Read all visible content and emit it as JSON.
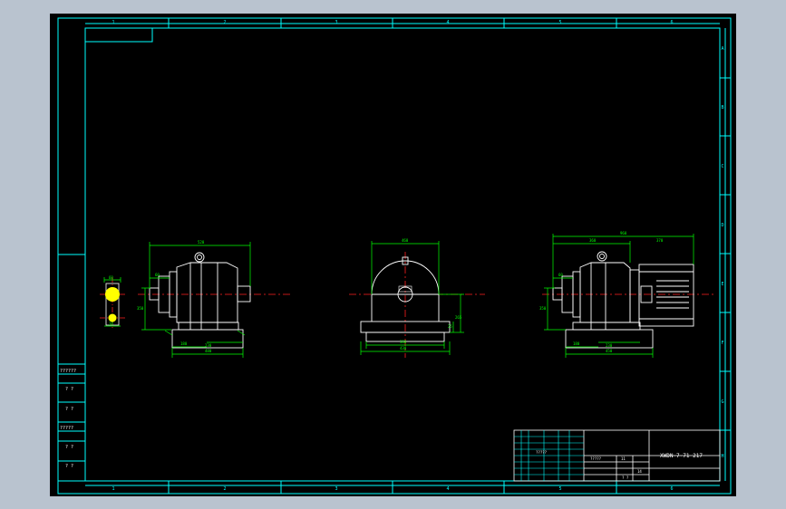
{
  "drawing": {
    "colors": {
      "background": "#000000",
      "frame": "#00ffff",
      "dimension": "#00ff00",
      "outline": "#ffffff",
      "centerline": "#ff2020",
      "title_text": "#ffffff",
      "highlight": "#ffff00",
      "window_bg": "#b9c3cf"
    },
    "zone_columns_top": [
      "1",
      "2",
      "3",
      "4",
      "5",
      "6"
    ],
    "zone_columns_bottom": [
      "1",
      "2",
      "3",
      "4",
      "5",
      "6"
    ],
    "zone_rows_right": [
      "A",
      "B",
      "C",
      "D",
      "E",
      "F",
      "G",
      "H"
    ],
    "title_block": {
      "drawing_code": "XWDN-7-71 217",
      "field_1": "?????",
      "field_2": "?????",
      "field_3": "11",
      "field_4": "14",
      "field_5": "?  ?"
    },
    "left_side_table": {
      "rows": [
        "??????",
        "?  ?",
        "?  ?",
        "?????",
        "?  ?",
        "?  ?"
      ]
    },
    "views": {
      "front_view": {
        "dims": {
          "overall_width": "520",
          "shaft_ext": "60",
          "height_1": "350",
          "foot_1": "180",
          "foot_2": "230",
          "foot_total": "480"
        }
      },
      "end_view": {
        "dims": {
          "top_width": "460",
          "center_height": "265",
          "foot_height": "25",
          "base_inner": "380",
          "base_outer": "430"
        }
      },
      "motor_view": {
        "dims": {
          "overall_length": "960",
          "seg_1": "360",
          "seg_2": "370",
          "shaft_ext": "60",
          "height_1": "350",
          "foot_1": "180",
          "foot_total": "450",
          "foot_2": "230"
        }
      },
      "detail_view": {
        "dims": {
          "d1": "60",
          "d2": "18"
        }
      }
    }
  }
}
